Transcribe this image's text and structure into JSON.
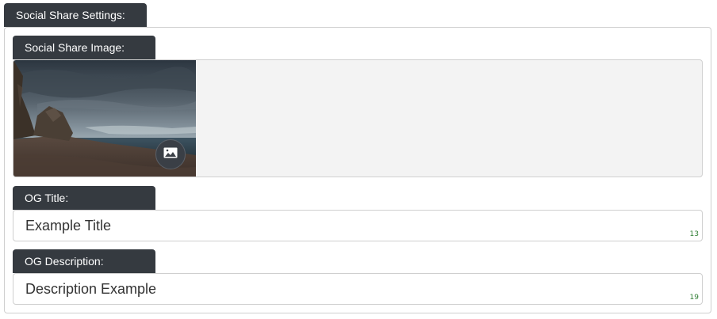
{
  "section": {
    "title": "Social Share Settings:"
  },
  "share_image": {
    "label": "Social Share Image:",
    "button_icon": "image-icon"
  },
  "og_title": {
    "label": "OG Title:",
    "value": "Example Title",
    "char_count": "13"
  },
  "og_description": {
    "label": "OG Description:",
    "value": "Description Example",
    "char_count": "19"
  },
  "colors": {
    "tab_bg": "#353a40",
    "counter": "#2e7d32",
    "image_area_bg": "#f3f3f3"
  }
}
